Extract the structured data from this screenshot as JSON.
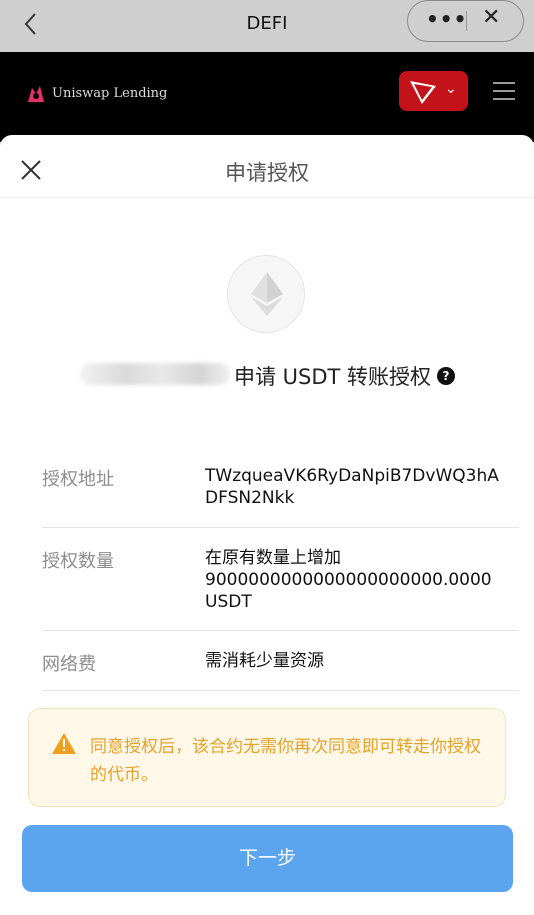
{
  "topbar": {
    "title": "DEFI"
  },
  "dapp": {
    "name": "Uniswap Lending"
  },
  "sheet": {
    "title": "申请授权",
    "request_line": "申请 USDT 转账授权",
    "rows": [
      {
        "label": "授权地址",
        "value": "TWzqueaVK6RyDaNpiB7DvWQ3hADFSN2Nkk"
      },
      {
        "label": "授权数量",
        "value_line1": "在原有数量上增加",
        "value_line2": "9000000000000000000000.0000",
        "value_line3": "USDT"
      },
      {
        "label": "网络费",
        "value": "需消耗少量资源"
      }
    ],
    "warning": "同意授权后，该合约无需你再次同意即可转走你授权的代币。",
    "next_button": "下一步"
  },
  "colors": {
    "tron_red": "#c4121b",
    "button_blue": "#5aa5ee",
    "warning_text": "#e5a22c"
  }
}
